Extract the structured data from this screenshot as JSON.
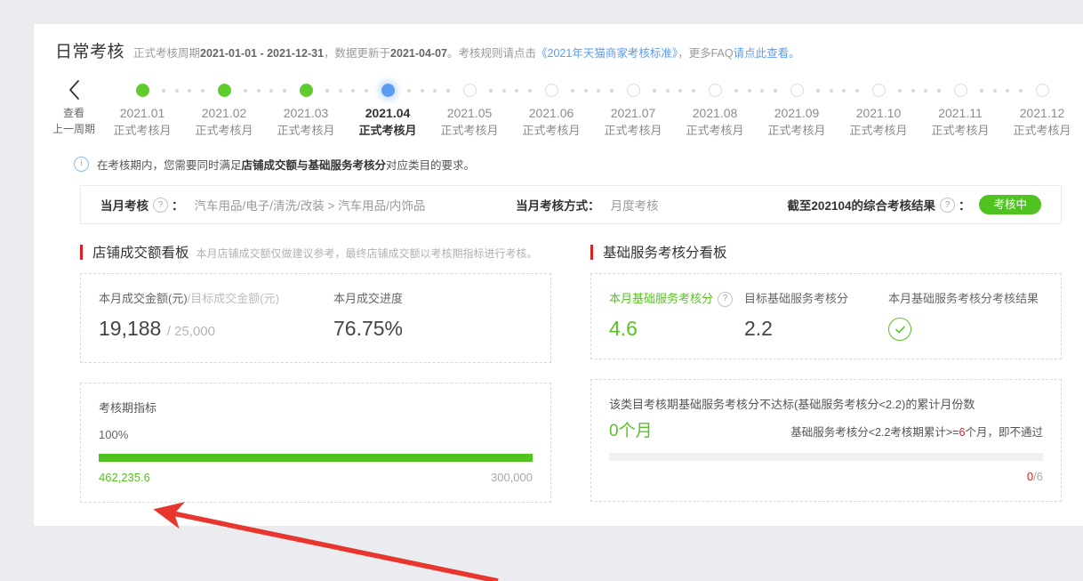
{
  "header": {
    "title": "日常考核",
    "subtitle_pre": "正式考核周期",
    "period": "2021-01-01 - 2021-12-31",
    "subtitle_mid": "，数据更新于",
    "update_date": "2021-04-07",
    "subtitle_rule": "。考核规则请点击",
    "rule_link": "《2021年天猫商家考核标准》",
    "subtitle_faq": "，更多FAQ",
    "faq_link": "请点此查看。"
  },
  "timeline": {
    "prev_label_line1": "查看",
    "prev_label_line2": "上一周期",
    "prev_icon": "chevron-left-icon",
    "months": [
      {
        "name": "2021.01",
        "type": "正式考核月",
        "state": "done"
      },
      {
        "name": "2021.02",
        "type": "正式考核月",
        "state": "done"
      },
      {
        "name": "2021.03",
        "type": "正式考核月",
        "state": "done"
      },
      {
        "name": "2021.04",
        "type": "正式考核月",
        "state": "current"
      },
      {
        "name": "2021.05",
        "type": "正式考核月",
        "state": "future"
      },
      {
        "name": "2021.06",
        "type": "正式考核月",
        "state": "future"
      },
      {
        "name": "2021.07",
        "type": "正式考核月",
        "state": "future"
      },
      {
        "name": "2021.08",
        "type": "正式考核月",
        "state": "future"
      },
      {
        "name": "2021.09",
        "type": "正式考核月",
        "state": "future"
      },
      {
        "name": "2021.10",
        "type": "正式考核月",
        "state": "future"
      },
      {
        "name": "2021.11",
        "type": "正式考核月",
        "state": "future"
      },
      {
        "name": "2021.12",
        "type": "正式考核月",
        "state": "future"
      }
    ]
  },
  "notice": {
    "text_pre": "在考核期内，您需要同时满足",
    "text_bold": "店铺成交额与基础服务考核分",
    "text_post": "对应类目的要求。"
  },
  "assessment": {
    "current_label": "当月考核",
    "current_colon": "：",
    "current_value": "汽车用品/电子/清洗/改装 > 汽车用品/内饰品",
    "method_label": "当月考核方式：",
    "method_value": "月度考核",
    "result_label": "截至202104的综合考核结果",
    "result_colon": "：",
    "result_badge": "考核中",
    "badge_color": "#4fc420"
  },
  "left_board": {
    "title": "店铺成交额看板",
    "note": "本月店铺成交额仅做建议参考，最终店铺成交额以考核期指标进行考核。",
    "metric_amount_label_main": "本月成交金额(元)",
    "metric_amount_label_sep": " / ",
    "metric_amount_label_target": "目标成交金额(元)",
    "metric_amount_value": "19,188",
    "metric_amount_sep": " / ",
    "metric_amount_target": "25,000",
    "metric_progress_label": "本月成交进度",
    "metric_progress_value": "76.75%",
    "period_card_title": "考核期指标",
    "period_pct": "100%",
    "period_bar_fill_pct": 100,
    "period_current": "462,235.6",
    "period_target": "300,000"
  },
  "right_board": {
    "title": "基础服务考核分看板",
    "metric_score_label": "本月基础服务考核分",
    "metric_score_value": "4.6",
    "metric_target_label": "目标基础服务考核分",
    "metric_target_value": "2.2",
    "metric_result_label": "本月基础服务考核分考核结果",
    "metric_result_icon": "check-circle-icon",
    "fail_card_title": "该类目考核期基础服务考核分不达标(基础服务考核分<2.2)的累计月份数",
    "fail_months": "0个月",
    "rule_pre": "基础服务考核分<2.2考核期累计>=",
    "rule_num": "6",
    "rule_post": "个月，即不通过",
    "fail_bar_fill_pct": 0,
    "frac_num": "0",
    "frac_den": "/6"
  },
  "annotation": {
    "arrow_color": "#e8352e",
    "arrow_name": "red-pointer-arrow"
  }
}
